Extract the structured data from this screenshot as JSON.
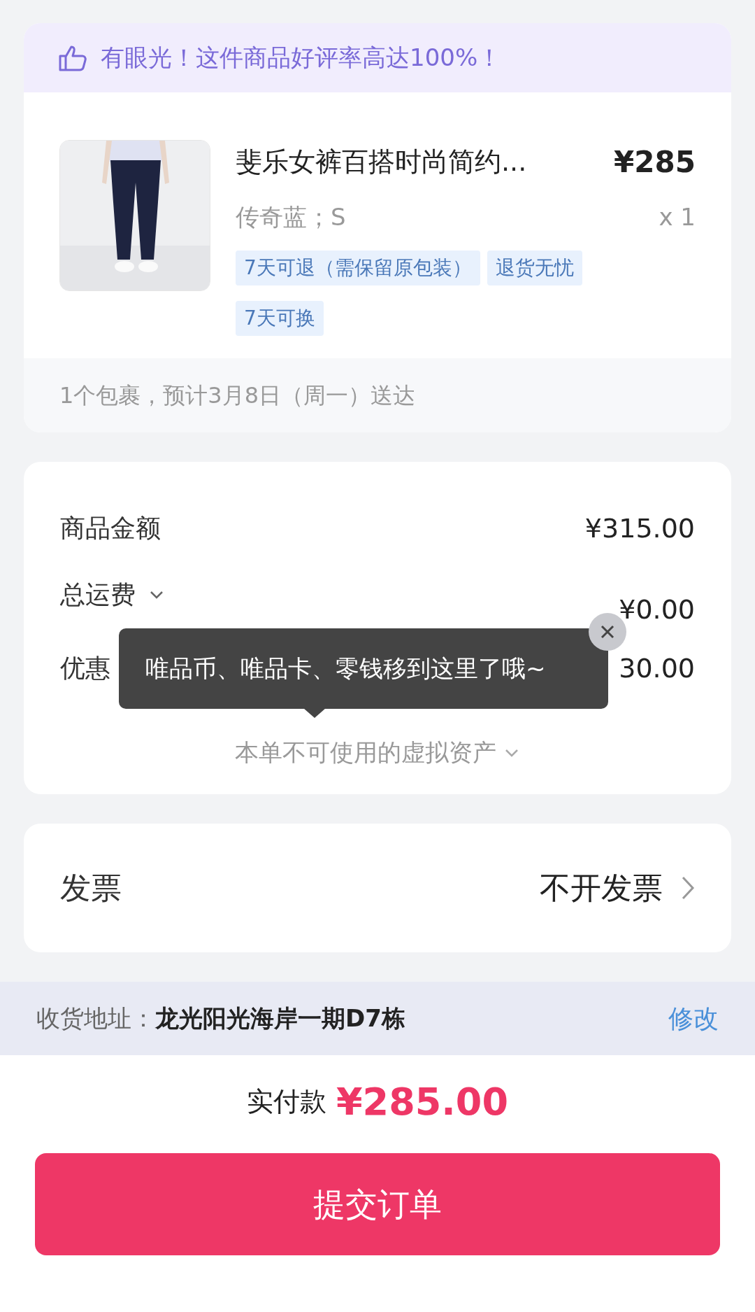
{
  "praise_banner": {
    "text": "有眼光！这件商品好评率高达100%！"
  },
  "product": {
    "title": "斐乐女裤百搭时尚简约...",
    "price": "¥285",
    "variant": "传奇蓝；S",
    "quantity": "x 1",
    "tags": [
      "7天可退（需保留原包装）",
      "退货无忧",
      "7天可换"
    ]
  },
  "delivery": "1个包裹，预计3月8日（周一）送达",
  "summary": {
    "rows": [
      {
        "label": "商品金额",
        "value": "¥315.00"
      },
      {
        "label": "总运费",
        "value": "¥0.00",
        "has_dropdown": true
      },
      {
        "label": "优惠",
        "value": "30.00"
      }
    ],
    "tooltip": "唯品币、唯品卡、零钱移到这里了哦~",
    "unusable_assets": "本单不可使用的虚拟资产"
  },
  "invoice": {
    "label": "发票",
    "value": "不开发票"
  },
  "address": {
    "label": "收货地址：",
    "value": "龙光阳光海岸一期D7栋",
    "action": "修改"
  },
  "payment": {
    "label": "实付款",
    "amount": "¥285.00"
  },
  "submit_button": "提交订单"
}
